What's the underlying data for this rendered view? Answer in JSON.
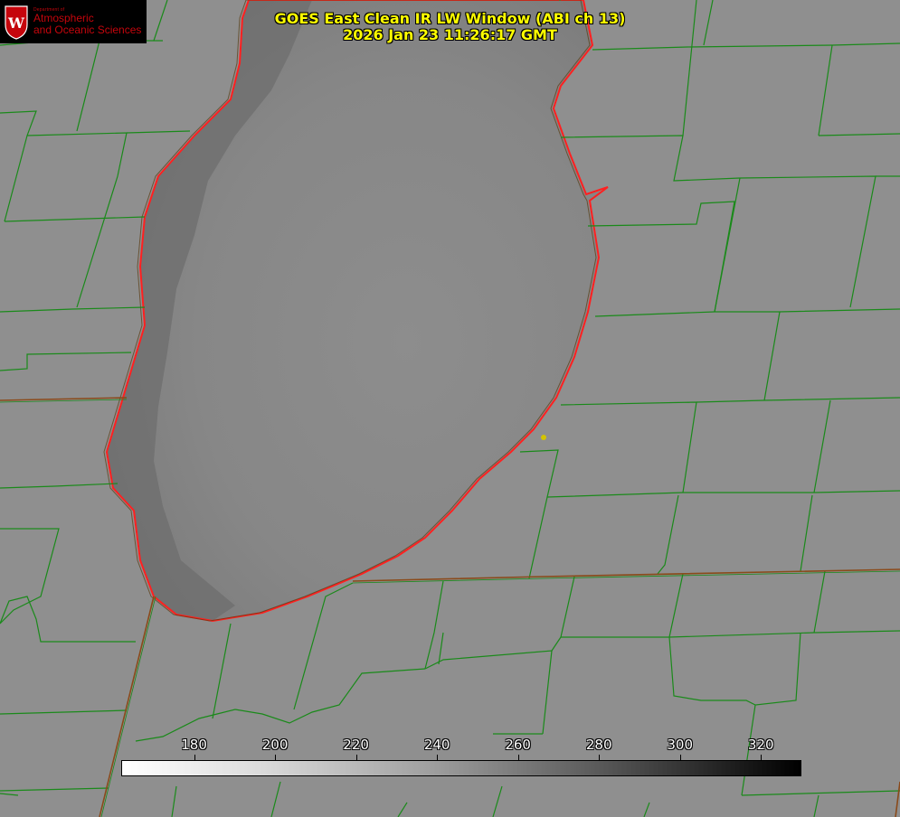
{
  "title": {
    "line1": "GOES East Clean IR LW Window (ABI ch 13)",
    "line2": "2026 Jan 23 11:26:17 GMT"
  },
  "logo": {
    "dept_small": "Department of",
    "line1": "Atmospheric",
    "line2": "and Oceanic Sciences",
    "seal_letter": "W"
  },
  "colorbar": {
    "min": 162,
    "max": 330,
    "ticks": [
      "180",
      "200",
      "220",
      "240",
      "260",
      "280",
      "300",
      "320"
    ],
    "colors": [
      "#ffffff",
      "#000000"
    ]
  },
  "colors": {
    "county_lines": "#1a8a1a",
    "shoreline": "#ff2020",
    "state_line": "#8a4a1a",
    "lake_dark": "#6f6f6f",
    "land": "#8e8e8e",
    "marker": "#d4c400"
  }
}
